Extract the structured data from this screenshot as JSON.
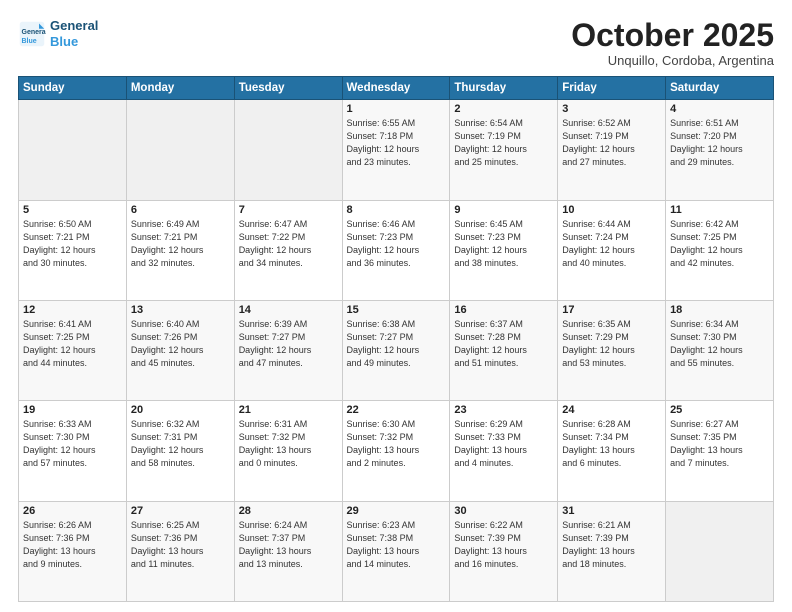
{
  "logo": {
    "line1": "General",
    "line2": "Blue"
  },
  "header": {
    "month": "October 2025",
    "location": "Unquillo, Cordoba, Argentina"
  },
  "weekdays": [
    "Sunday",
    "Monday",
    "Tuesday",
    "Wednesday",
    "Thursday",
    "Friday",
    "Saturday"
  ],
  "weeks": [
    [
      {
        "day": "",
        "info": ""
      },
      {
        "day": "",
        "info": ""
      },
      {
        "day": "",
        "info": ""
      },
      {
        "day": "1",
        "info": "Sunrise: 6:55 AM\nSunset: 7:18 PM\nDaylight: 12 hours\nand 23 minutes."
      },
      {
        "day": "2",
        "info": "Sunrise: 6:54 AM\nSunset: 7:19 PM\nDaylight: 12 hours\nand 25 minutes."
      },
      {
        "day": "3",
        "info": "Sunrise: 6:52 AM\nSunset: 7:19 PM\nDaylight: 12 hours\nand 27 minutes."
      },
      {
        "day": "4",
        "info": "Sunrise: 6:51 AM\nSunset: 7:20 PM\nDaylight: 12 hours\nand 29 minutes."
      }
    ],
    [
      {
        "day": "5",
        "info": "Sunrise: 6:50 AM\nSunset: 7:21 PM\nDaylight: 12 hours\nand 30 minutes."
      },
      {
        "day": "6",
        "info": "Sunrise: 6:49 AM\nSunset: 7:21 PM\nDaylight: 12 hours\nand 32 minutes."
      },
      {
        "day": "7",
        "info": "Sunrise: 6:47 AM\nSunset: 7:22 PM\nDaylight: 12 hours\nand 34 minutes."
      },
      {
        "day": "8",
        "info": "Sunrise: 6:46 AM\nSunset: 7:23 PM\nDaylight: 12 hours\nand 36 minutes."
      },
      {
        "day": "9",
        "info": "Sunrise: 6:45 AM\nSunset: 7:23 PM\nDaylight: 12 hours\nand 38 minutes."
      },
      {
        "day": "10",
        "info": "Sunrise: 6:44 AM\nSunset: 7:24 PM\nDaylight: 12 hours\nand 40 minutes."
      },
      {
        "day": "11",
        "info": "Sunrise: 6:42 AM\nSunset: 7:25 PM\nDaylight: 12 hours\nand 42 minutes."
      }
    ],
    [
      {
        "day": "12",
        "info": "Sunrise: 6:41 AM\nSunset: 7:25 PM\nDaylight: 12 hours\nand 44 minutes."
      },
      {
        "day": "13",
        "info": "Sunrise: 6:40 AM\nSunset: 7:26 PM\nDaylight: 12 hours\nand 45 minutes."
      },
      {
        "day": "14",
        "info": "Sunrise: 6:39 AM\nSunset: 7:27 PM\nDaylight: 12 hours\nand 47 minutes."
      },
      {
        "day": "15",
        "info": "Sunrise: 6:38 AM\nSunset: 7:27 PM\nDaylight: 12 hours\nand 49 minutes."
      },
      {
        "day": "16",
        "info": "Sunrise: 6:37 AM\nSunset: 7:28 PM\nDaylight: 12 hours\nand 51 minutes."
      },
      {
        "day": "17",
        "info": "Sunrise: 6:35 AM\nSunset: 7:29 PM\nDaylight: 12 hours\nand 53 minutes."
      },
      {
        "day": "18",
        "info": "Sunrise: 6:34 AM\nSunset: 7:30 PM\nDaylight: 12 hours\nand 55 minutes."
      }
    ],
    [
      {
        "day": "19",
        "info": "Sunrise: 6:33 AM\nSunset: 7:30 PM\nDaylight: 12 hours\nand 57 minutes."
      },
      {
        "day": "20",
        "info": "Sunrise: 6:32 AM\nSunset: 7:31 PM\nDaylight: 12 hours\nand 58 minutes."
      },
      {
        "day": "21",
        "info": "Sunrise: 6:31 AM\nSunset: 7:32 PM\nDaylight: 13 hours\nand 0 minutes."
      },
      {
        "day": "22",
        "info": "Sunrise: 6:30 AM\nSunset: 7:32 PM\nDaylight: 13 hours\nand 2 minutes."
      },
      {
        "day": "23",
        "info": "Sunrise: 6:29 AM\nSunset: 7:33 PM\nDaylight: 13 hours\nand 4 minutes."
      },
      {
        "day": "24",
        "info": "Sunrise: 6:28 AM\nSunset: 7:34 PM\nDaylight: 13 hours\nand 6 minutes."
      },
      {
        "day": "25",
        "info": "Sunrise: 6:27 AM\nSunset: 7:35 PM\nDaylight: 13 hours\nand 7 minutes."
      }
    ],
    [
      {
        "day": "26",
        "info": "Sunrise: 6:26 AM\nSunset: 7:36 PM\nDaylight: 13 hours\nand 9 minutes."
      },
      {
        "day": "27",
        "info": "Sunrise: 6:25 AM\nSunset: 7:36 PM\nDaylight: 13 hours\nand 11 minutes."
      },
      {
        "day": "28",
        "info": "Sunrise: 6:24 AM\nSunset: 7:37 PM\nDaylight: 13 hours\nand 13 minutes."
      },
      {
        "day": "29",
        "info": "Sunrise: 6:23 AM\nSunset: 7:38 PM\nDaylight: 13 hours\nand 14 minutes."
      },
      {
        "day": "30",
        "info": "Sunrise: 6:22 AM\nSunset: 7:39 PM\nDaylight: 13 hours\nand 16 minutes."
      },
      {
        "day": "31",
        "info": "Sunrise: 6:21 AM\nSunset: 7:39 PM\nDaylight: 13 hours\nand 18 minutes."
      },
      {
        "day": "",
        "info": ""
      }
    ]
  ]
}
